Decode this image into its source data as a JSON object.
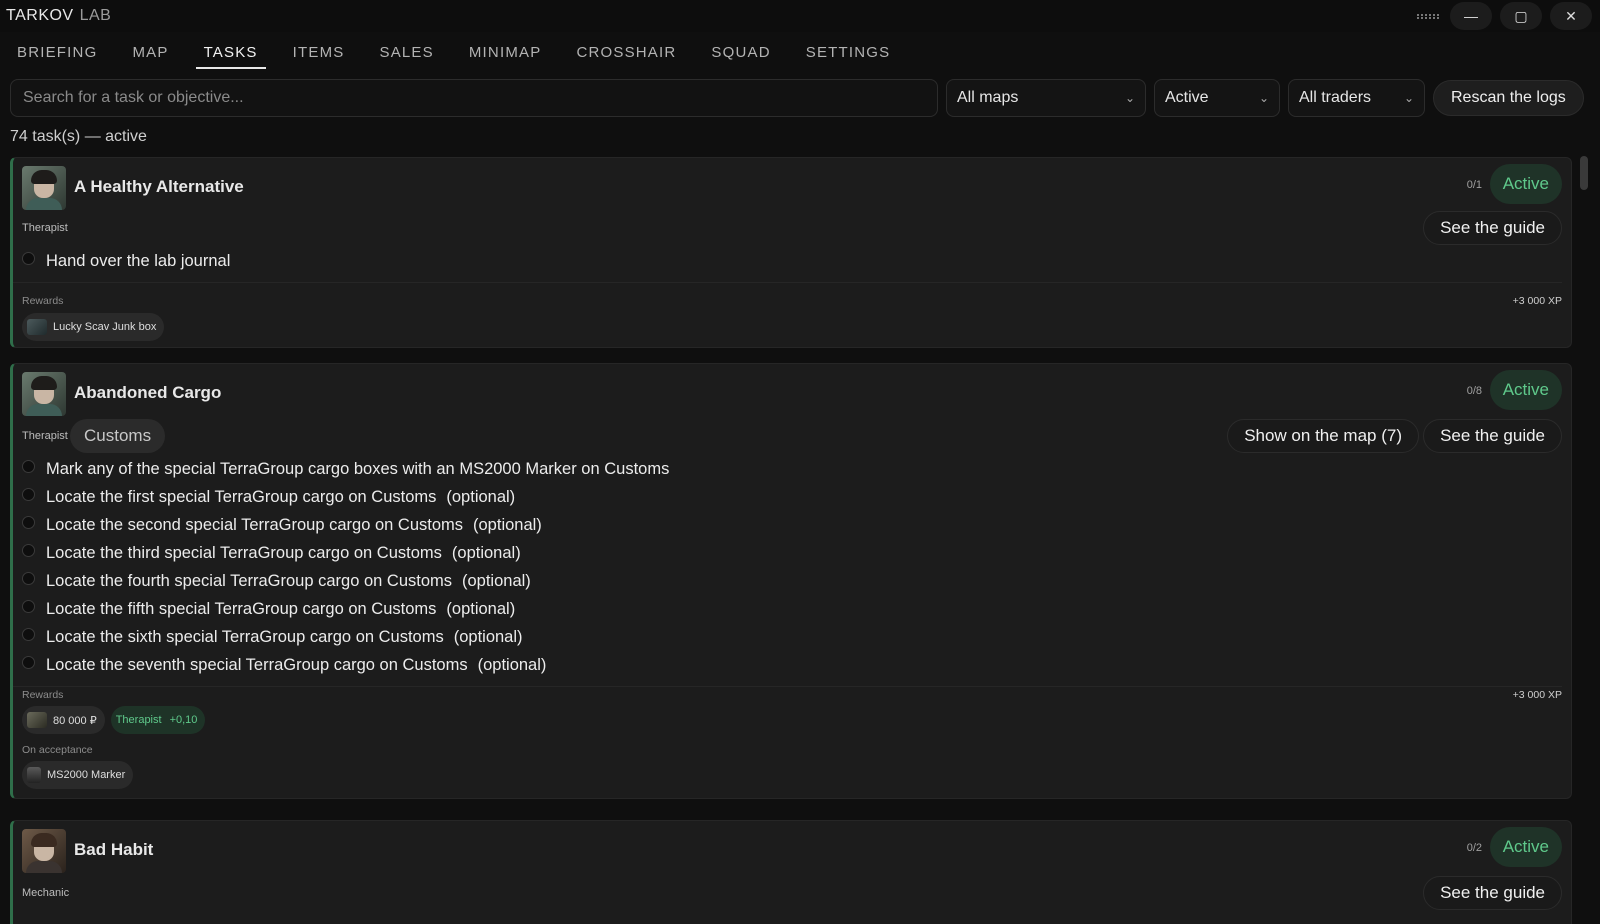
{
  "app": {
    "title_main": "TARKOV",
    "title_light": "LAB"
  },
  "window_controls": {
    "grip_icon": "drag-grip-icon",
    "minimize": "—",
    "maximize": "▢",
    "close": "✕"
  },
  "nav": {
    "tabs": [
      {
        "label": "BRIEFING",
        "active": false
      },
      {
        "label": "MAP",
        "active": false
      },
      {
        "label": "TASKS",
        "active": true
      },
      {
        "label": "ITEMS",
        "active": false
      },
      {
        "label": "SALES",
        "active": false
      },
      {
        "label": "MINIMAP",
        "active": false
      },
      {
        "label": "CROSSHAIR",
        "active": false
      },
      {
        "label": "SQUAD",
        "active": false
      },
      {
        "label": "SETTINGS",
        "active": false
      }
    ]
  },
  "filters": {
    "search_placeholder": "Search for a task or objective...",
    "search_value": "",
    "map": "All maps",
    "status": "Active",
    "trader": "All traders",
    "rescan_label": "Rescan the logs",
    "chevron": "⌄"
  },
  "summary": {
    "count_text": "74 task(s) — active"
  },
  "tasks": [
    {
      "title": "A Healthy Alternative",
      "trader": "Therapist",
      "progress": "0/1",
      "status": "Active",
      "guide_label": "See the guide",
      "objectives": [
        {
          "text": "Hand over the lab journal",
          "optional": ""
        }
      ],
      "rewards_label": "Rewards",
      "xp": "+3 000 XP",
      "rewards": [
        {
          "label": "Lucky Scav Junk box"
        }
      ]
    },
    {
      "title": "Abandoned Cargo",
      "trader": "Therapist",
      "map_tag": "Customs",
      "progress": "0/8",
      "status": "Active",
      "show_map_label": "Show on the map (7)",
      "guide_label": "See the guide",
      "objectives": [
        {
          "text": "Mark any of the special TerraGroup cargo boxes with an MS2000 Marker on Customs",
          "optional": ""
        },
        {
          "text": "Locate the first special TerraGroup cargo on Customs",
          "optional": "(optional)"
        },
        {
          "text": "Locate the second special TerraGroup cargo on Customs",
          "optional": "(optional)"
        },
        {
          "text": "Locate the third special TerraGroup cargo on Customs",
          "optional": "(optional)"
        },
        {
          "text": "Locate the fourth special TerraGroup cargo on Customs",
          "optional": "(optional)"
        },
        {
          "text": "Locate the fifth special TerraGroup cargo on Customs",
          "optional": "(optional)"
        },
        {
          "text": "Locate the sixth special TerraGroup cargo on Customs",
          "optional": "(optional)"
        },
        {
          "text": "Locate the seventh special TerraGroup cargo on Customs",
          "optional": "(optional)"
        }
      ],
      "rewards_label": "Rewards",
      "xp": "+3 000 XP",
      "rewards": [
        {
          "label": "80 000 ₽"
        }
      ],
      "rep_reward": {
        "trader": "Therapist",
        "amount": "+0,10"
      },
      "acceptance_label": "On acceptance",
      "acceptance_items": [
        {
          "label": "MS2000 Marker"
        }
      ]
    },
    {
      "title": "Bad Habit",
      "trader": "Mechanic",
      "progress": "0/2",
      "status": "Active",
      "guide_label": "See the guide"
    }
  ],
  "colors": {
    "accent_green": "#5fc98b",
    "card_bg": "#1c1c1c",
    "app_bg": "#0f0f0f"
  }
}
